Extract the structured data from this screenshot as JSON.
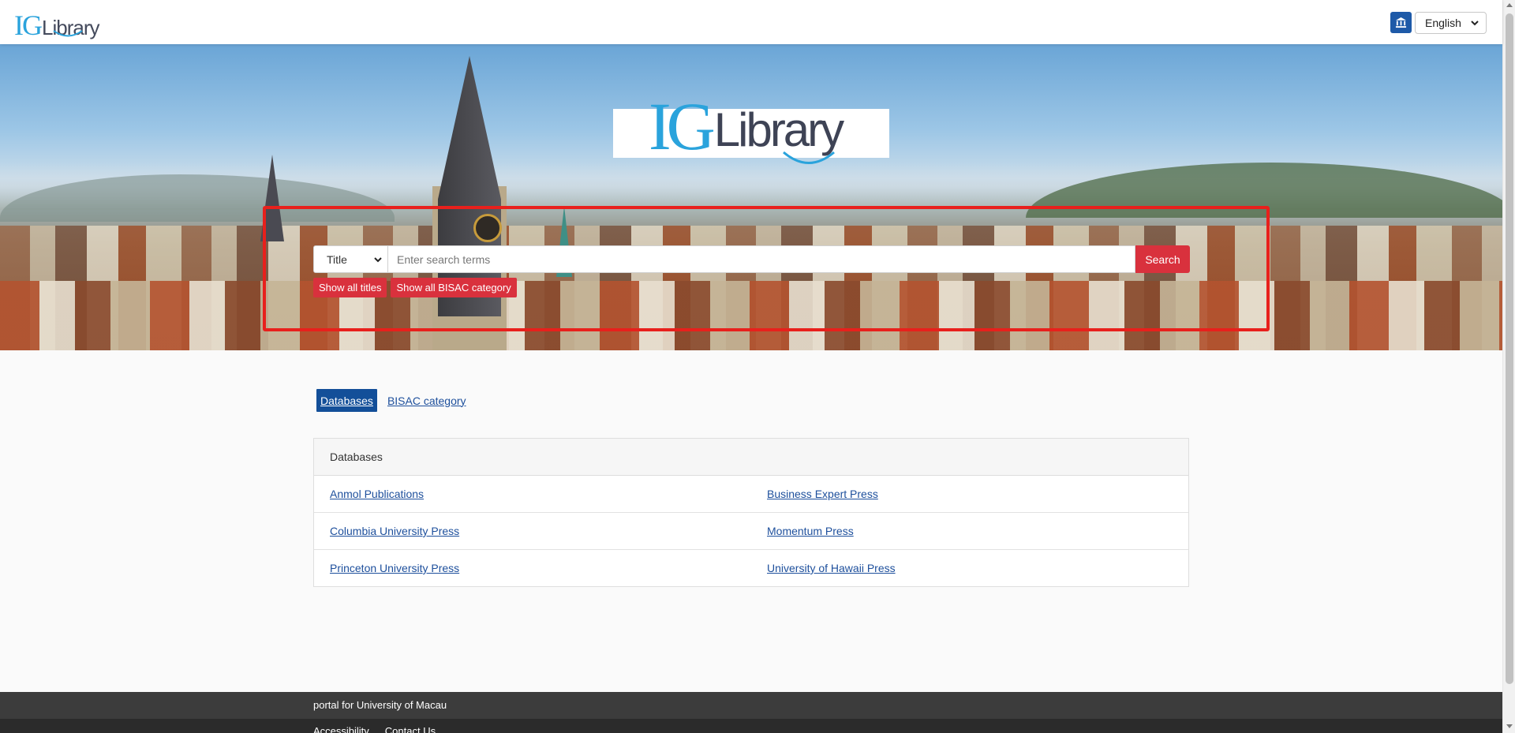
{
  "header": {
    "logo_ig": "IG",
    "logo_lib": "Library",
    "institution_icon": "bank-icon",
    "language": "English"
  },
  "hero": {
    "logo_ig": "IG",
    "logo_lib": "Library",
    "search": {
      "field": "Title",
      "placeholder": "Enter search terms",
      "button_label": "Search"
    },
    "quick_buttons": [
      "Show all titles",
      "Show all BISAC category"
    ]
  },
  "tabs": [
    {
      "label": "Databases",
      "active": true
    },
    {
      "label": "BISAC category",
      "active": false
    }
  ],
  "panel": {
    "title": "Databases",
    "rows": [
      [
        "Anmol Publications",
        "Business Expert Press"
      ],
      [
        "Columbia University Press",
        "Momentum Press"
      ],
      [
        "Princeton University Press",
        "University of Hawaii Press"
      ]
    ]
  },
  "footer": {
    "portal_text": "portal for University of Macau",
    "links": [
      "Accessibility",
      "Contact Us"
    ]
  },
  "colors": {
    "accent_red": "#d9313d",
    "primary_blue": "#134f99",
    "logo_blue": "#2aa3dc",
    "highlight_frame": "#e8201c"
  }
}
